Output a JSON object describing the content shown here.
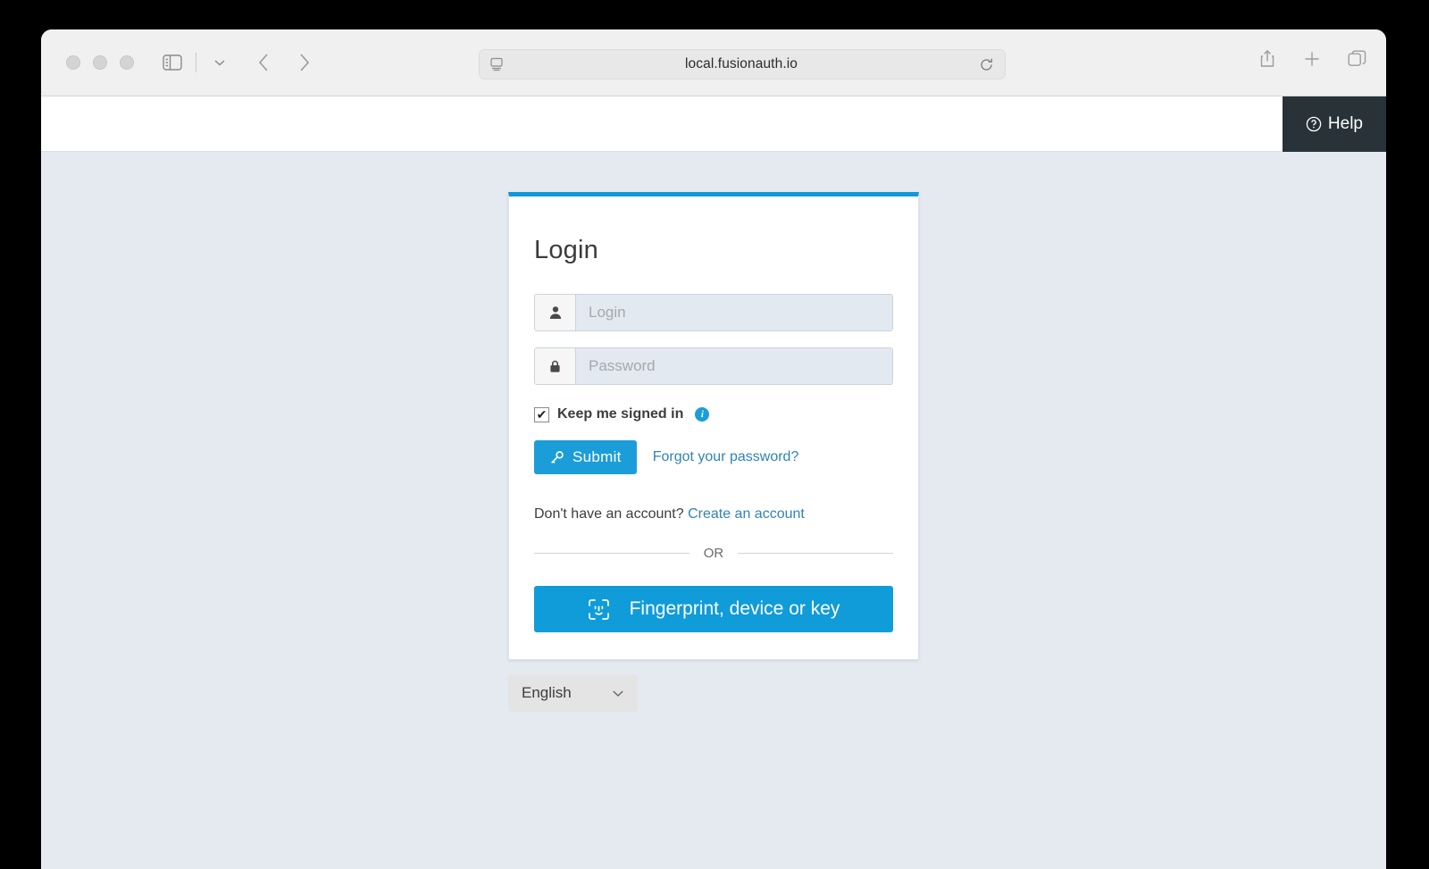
{
  "browser": {
    "url": "local.fusionauth.io",
    "traffic_lights": [
      "close-button",
      "minimize-button",
      "zoom-button"
    ],
    "toolbar_icons": {
      "sidebar": "sidebar-icon",
      "sidebar_chevron": "chevron-down-icon",
      "back": "back-arrow-icon",
      "forward": "forward-arrow-icon",
      "url_page": "page-settings-icon",
      "reload": "reload-icon",
      "share": "share-icon",
      "new_tab": "plus-icon",
      "tab_overview": "tab-overview-icon"
    }
  },
  "site_header": {
    "help_label": "Help",
    "help_icon": "question-circle-icon"
  },
  "login_card": {
    "title": "Login",
    "fields": [
      {
        "name": "loginId",
        "placeholder": "Login",
        "value": "",
        "icon": "user-icon"
      },
      {
        "name": "password",
        "placeholder": "Password",
        "value": "",
        "icon": "lock-icon"
      }
    ],
    "keep_signed_in": {
      "label": "Keep me signed in",
      "checked": true,
      "check_glyph": "✔",
      "info_icon": "info-icon",
      "info_glyph": "i"
    },
    "submit_label": "Submit",
    "submit_icon": "key-icon",
    "forgot_password_label": "Forgot your password?",
    "signup_prompt": "Don't have an account?",
    "signup_link_label": "Create an account",
    "or_label": "OR",
    "webauthn_label": "Fingerprint, device or key",
    "webauthn_icon": "face-id-icon"
  },
  "language_select": {
    "value": "English",
    "chevron": "chevron-down-icon"
  },
  "colors": {
    "accent_blue": "#109cd8",
    "link_blue": "#3083b5",
    "card_top_border": "#0f97da",
    "page_background": "#e5eaf1",
    "help_background": "#283238",
    "input_background": "#e3e9f0"
  }
}
